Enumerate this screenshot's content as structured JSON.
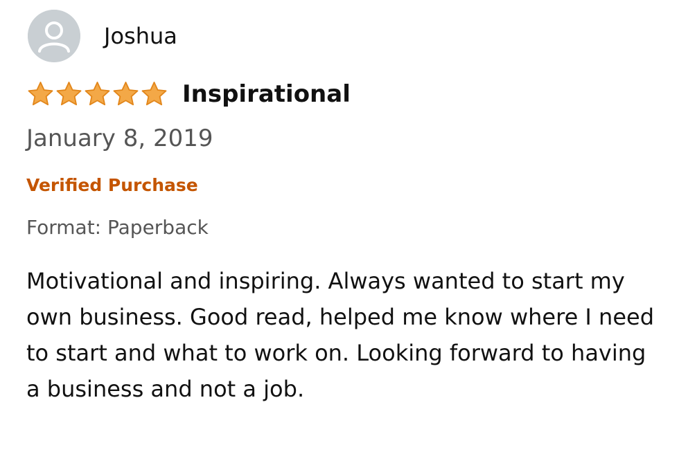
{
  "review": {
    "author": {
      "name": "Joshua",
      "avatar_icon": "default-user-avatar-icon"
    },
    "rating": {
      "stars": 5,
      "max": 5,
      "star_color": "#f3a847",
      "star_outline": "#e2861a"
    },
    "title": "Inspirational",
    "date": "January 8, 2019",
    "verified_label": "Verified Purchase",
    "verified_color": "#c45500",
    "format": "Format: Paperback",
    "body": "Motivational and inspiring. Always wanted to start my own business. Good read, helped me know where I need to start and what to work on. Looking forward to having a business and not a job."
  }
}
